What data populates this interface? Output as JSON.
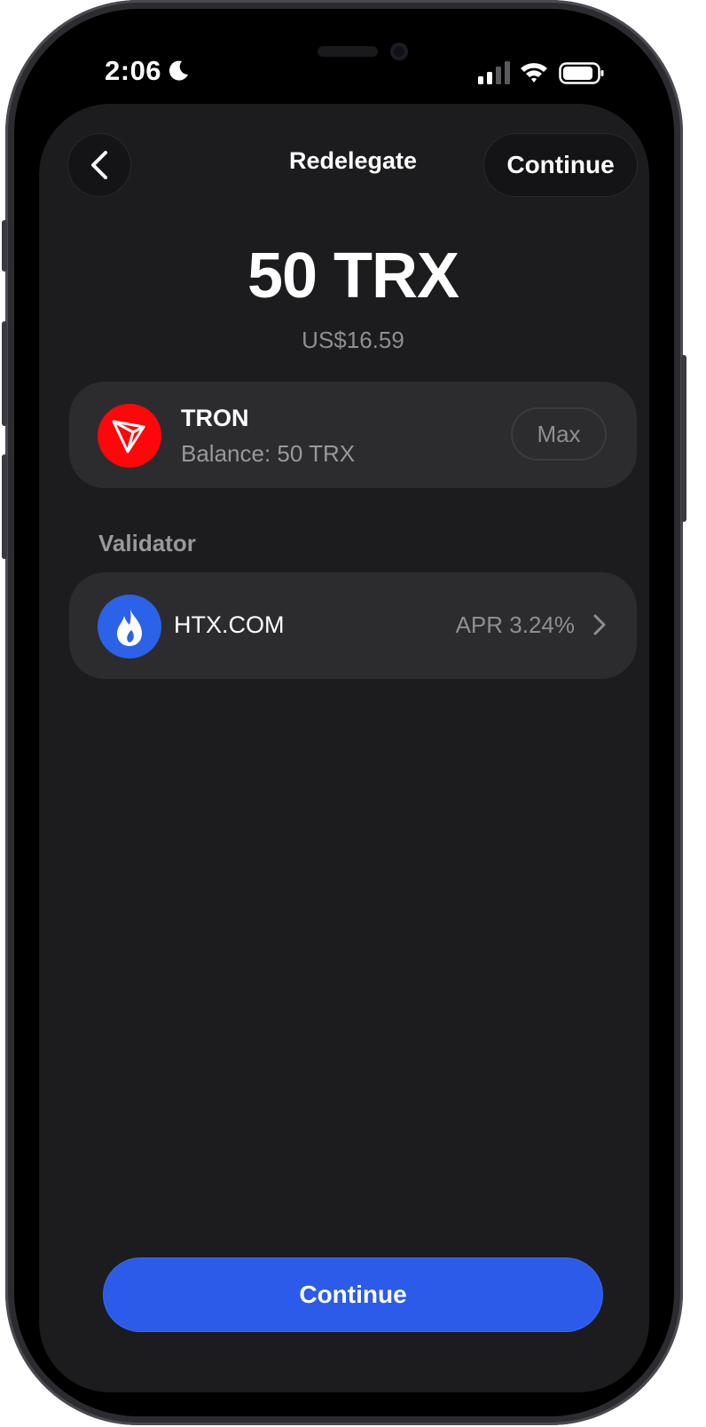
{
  "status_bar": {
    "time": "2:06",
    "icons": [
      "moon-icon",
      "cellular-signal-icon",
      "wifi-icon",
      "battery-icon"
    ]
  },
  "header": {
    "title": "Redelegate",
    "continue_label": "Continue",
    "back_icon": "chevron-left-icon"
  },
  "amount": {
    "value": "50 TRX",
    "fiat": "US$16.59"
  },
  "token": {
    "name": "TRON",
    "balance": "Balance: 50 TRX",
    "max_label": "Max",
    "icon": "tron-logo-icon",
    "color": "#ff060a"
  },
  "validator": {
    "section_label": "Validator",
    "name": "HTX.COM",
    "apr": "APR 3.24%",
    "icon": "htx-logo-icon",
    "color": "#2b62e8"
  },
  "footer": {
    "continue_label": "Continue",
    "accent": "#2b5be8"
  }
}
